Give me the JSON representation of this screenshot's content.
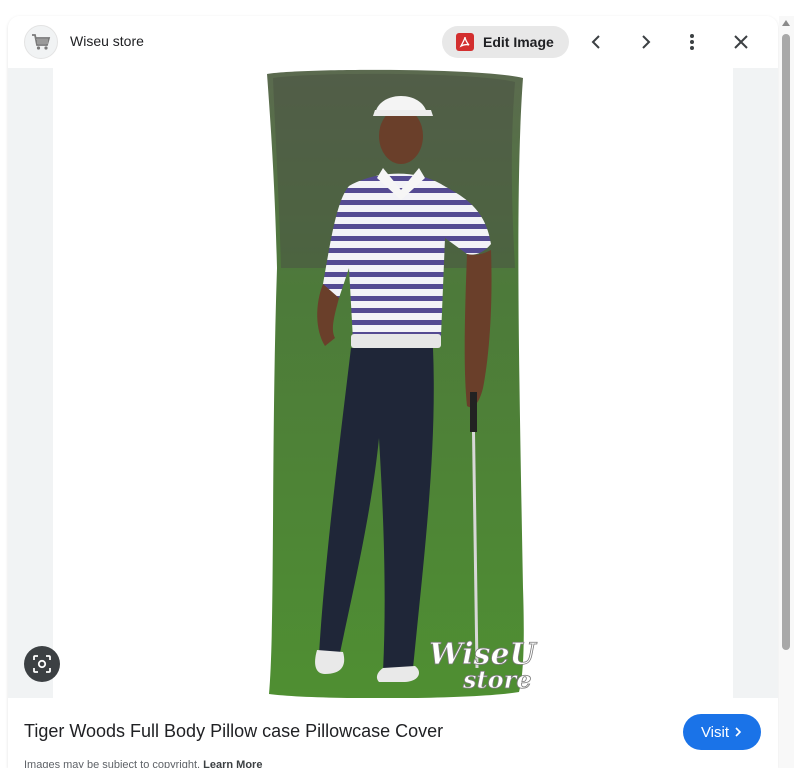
{
  "header": {
    "site_name": "Wiseu store",
    "site_icon": "shopping-cart-icon",
    "edit_label": "Edit Image",
    "edit_icon": "pdf-icon",
    "prev_icon": "chevron-left-icon",
    "next_icon": "chevron-right-icon",
    "more_icon": "more-vertical-icon",
    "close_icon": "close-icon"
  },
  "image": {
    "watermark_line1": "WiseU",
    "watermark_line2": "store"
  },
  "caption": {
    "title": "Tiger Woods Full Body Pillow case Pillowcase Cover",
    "visit_label": "Visit",
    "copyright_text": "Images may be subject to copyright.",
    "learn_more": "Learn More"
  },
  "colors": {
    "accent": "#1a73e8",
    "edit_bg": "#e8e8e8",
    "pdf_red": "#d32f2f",
    "image_bg": "#f1f3f4"
  }
}
